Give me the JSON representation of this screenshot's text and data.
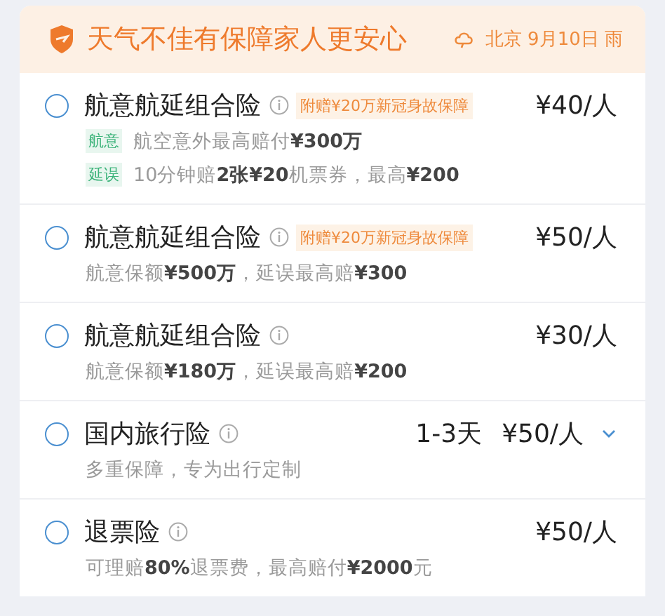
{
  "banner": {
    "title": "天气不佳有保障家人更安心",
    "weather": "北京 9月10日 雨"
  },
  "plans": [
    {
      "title": "航意航延组合险",
      "selected": false,
      "badge": "附赠¥20万新冠身故保障",
      "price": "¥40/人",
      "details": [
        {
          "tag": "航意",
          "text": "航空意外最高赔付**¥300万**"
        },
        {
          "tag": "延误",
          "text": "10分钟赔**2张¥20**机票券，最高**¥200**"
        }
      ]
    },
    {
      "title": "航意航延组合险",
      "selected": false,
      "badge": "附赠¥20万新冠身故保障",
      "price": "¥50/人",
      "details": [
        {
          "text": "航意保额**¥500万**，延误最高赔**¥300**"
        }
      ]
    },
    {
      "title": "航意航延组合险",
      "selected": false,
      "price": "¥30/人",
      "details": [
        {
          "text": "航意保额**¥180万**，延误最高赔**¥200**"
        }
      ]
    },
    {
      "title": "国内旅行险",
      "selected": false,
      "duration": "1-3天",
      "price": "¥50/人",
      "expandable": true,
      "details": [
        {
          "text": "多重保障，专为出行定制"
        }
      ]
    },
    {
      "title": "退票险",
      "selected": false,
      "price": "¥50/人",
      "details": [
        {
          "text": "可理赔**80%**退票费，最高赔付**¥2000**元"
        }
      ]
    }
  ]
}
